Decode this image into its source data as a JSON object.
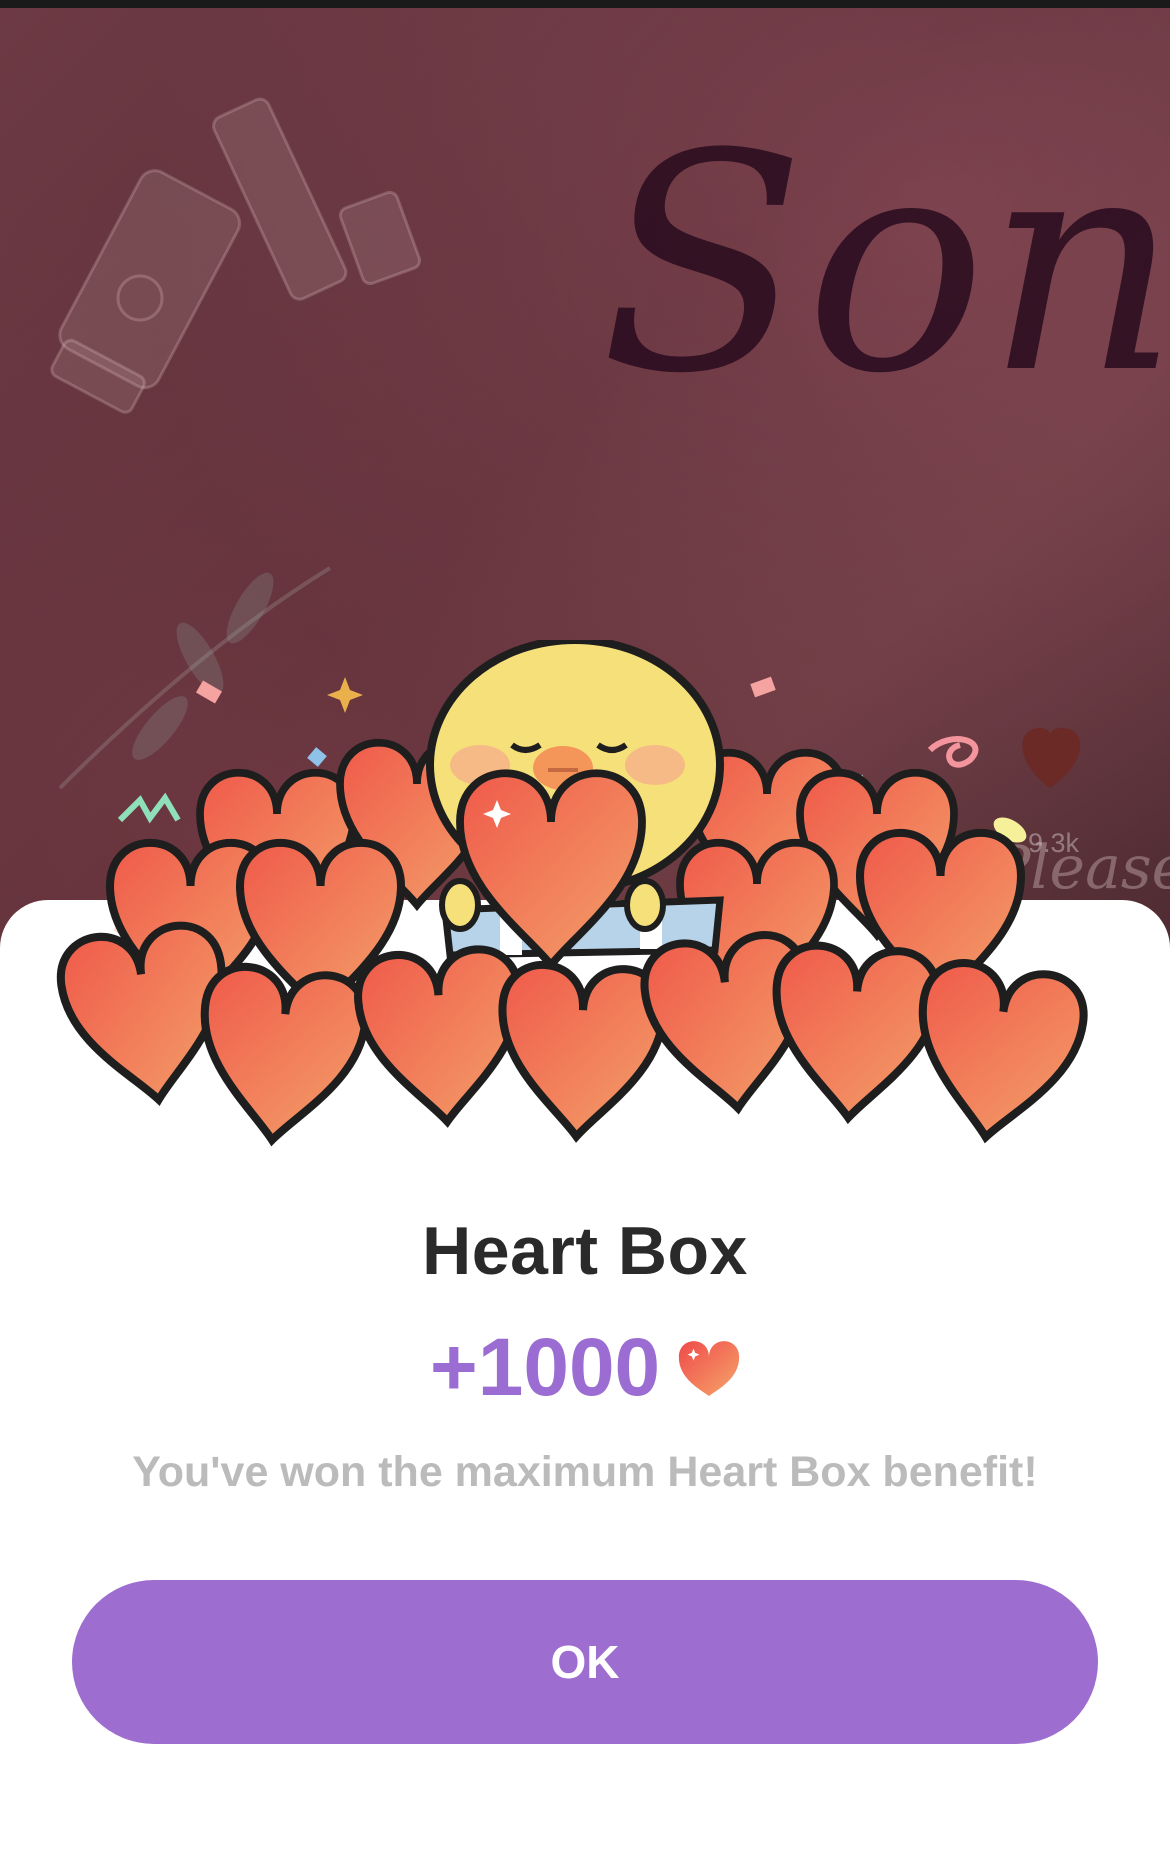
{
  "background": {
    "likes_count": "9.3k",
    "script_text": "Son Ye",
    "caption_text": "Please"
  },
  "dialog": {
    "title": "Heart Box",
    "reward_amount": "+1000",
    "reward_icon": "heart-icon",
    "message": "You've won the maximum Heart Box benefit!",
    "ok_label": "OK"
  },
  "colors": {
    "accent": "#9d6ecf",
    "amount": "#9b6cd1",
    "heart": "#f06a50"
  }
}
